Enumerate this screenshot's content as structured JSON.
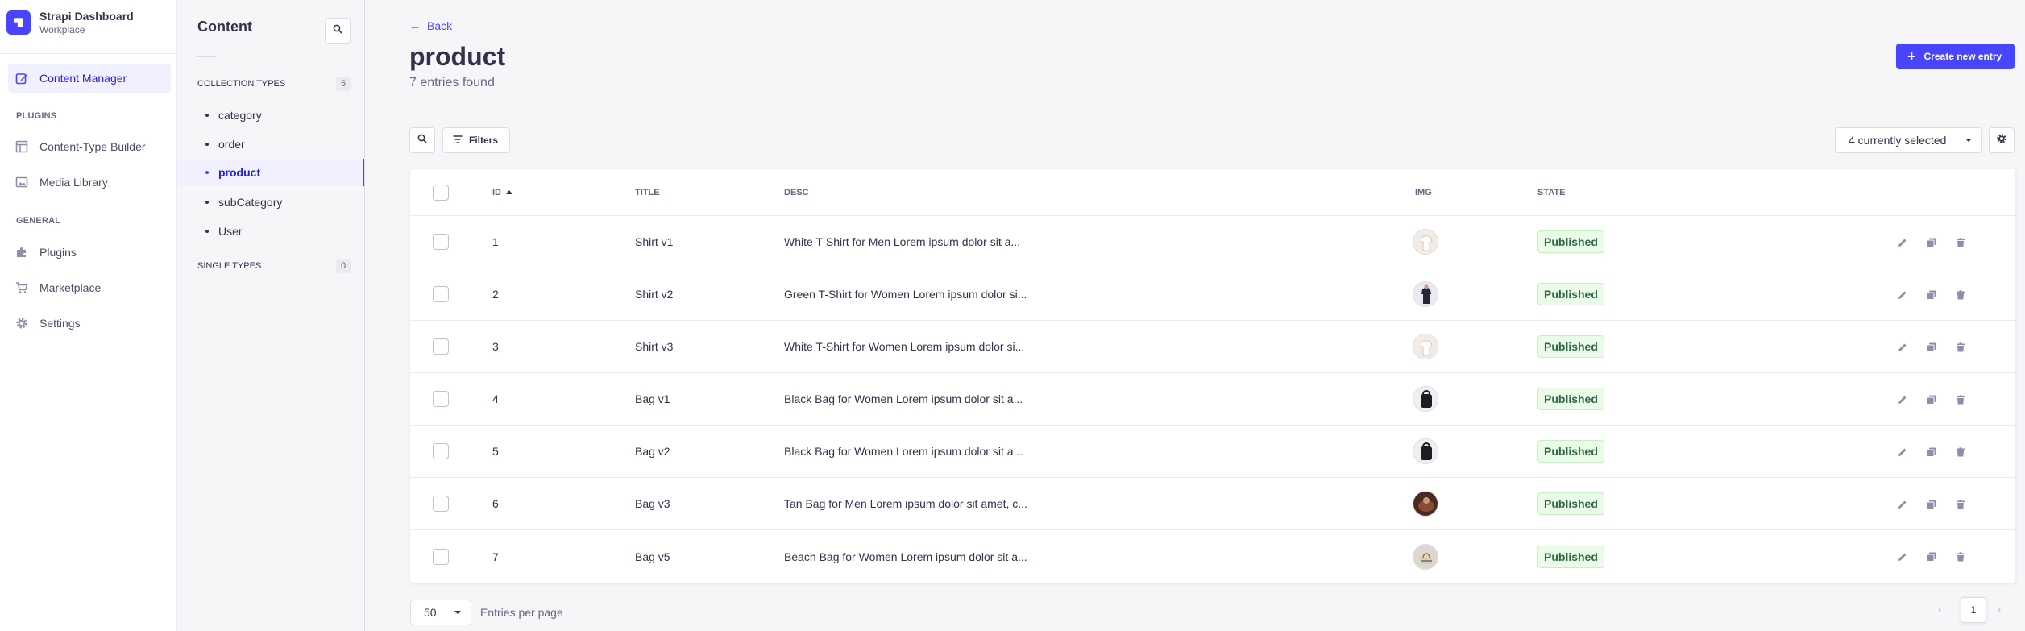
{
  "brand": {
    "title": "Strapi Dashboard",
    "subtitle": "Workplace"
  },
  "mainnav": {
    "content_manager": "Content Manager",
    "plugins_section": "PLUGINS",
    "content_type_builder": "Content-Type Builder",
    "media_library": "Media Library",
    "general_section": "GENERAL",
    "plugins": "Plugins",
    "marketplace": "Marketplace",
    "settings": "Settings"
  },
  "subnav": {
    "title": "Content",
    "collection_types_label": "COLLECTION TYPES",
    "collection_types_count": "5",
    "items": [
      "category",
      "order",
      "product",
      "subCategory",
      "User"
    ],
    "active_item": "product",
    "single_types_label": "SINGLE TYPES",
    "single_types_count": "0"
  },
  "header": {
    "back": "Back",
    "title": "product",
    "subtitle": "7 entries found",
    "create_button": "Create new entry"
  },
  "toolbar": {
    "filters": "Filters",
    "columns_select": "4 currently selected"
  },
  "table": {
    "columns": {
      "id": "ID",
      "title": "TITLE",
      "desc": "DESC",
      "img": "IMG",
      "state": "STATE"
    },
    "rows": [
      {
        "id": "1",
        "title": "Shirt v1",
        "desc": "White T-Shirt for Men Lorem ipsum dolor sit a...",
        "state": "Published",
        "img_icon": "shirt-white-thumbnail"
      },
      {
        "id": "2",
        "title": "Shirt v2",
        "desc": "Green T-Shirt for Women Lorem ipsum dolor si...",
        "state": "Published",
        "img_icon": "shirt-dark-thumbnail"
      },
      {
        "id": "3",
        "title": "Shirt v3",
        "desc": "White T-Shirt for Women Lorem ipsum dolor si...",
        "state": "Published",
        "img_icon": "shirt-white-thumbnail"
      },
      {
        "id": "4",
        "title": "Bag v1",
        "desc": "Black Bag for Women Lorem ipsum dolor sit a...",
        "state": "Published",
        "img_icon": "bag-black-thumbnail"
      },
      {
        "id": "5",
        "title": "Bag v2",
        "desc": "Black Bag for Women Lorem ipsum dolor sit a...",
        "state": "Published",
        "img_icon": "bag-black-thumbnail"
      },
      {
        "id": "6",
        "title": "Bag v3",
        "desc": "Tan Bag for Men Lorem ipsum dolor sit amet, c...",
        "state": "Published",
        "img_icon": "bag-tan-thumbnail"
      },
      {
        "id": "7",
        "title": "Bag v5",
        "desc": "Beach Bag for Women Lorem ipsum dolor sit a...",
        "state": "Published",
        "img_icon": "bag-beach-thumbnail"
      }
    ]
  },
  "pagination": {
    "per_page": "50",
    "per_page_label": "Entries per page",
    "current_page": "1"
  },
  "colors": {
    "primary": "#4945ff",
    "success_bg": "#eafbe7",
    "success_text": "#2f6846"
  }
}
